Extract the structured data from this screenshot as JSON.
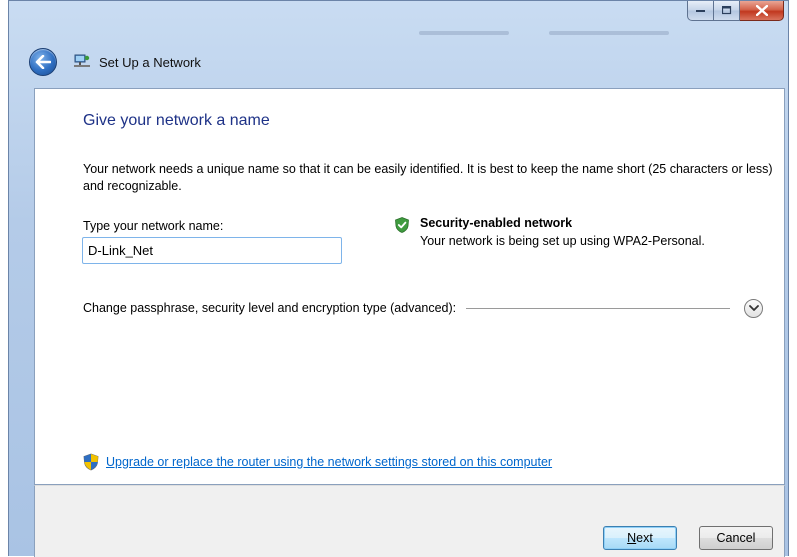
{
  "window": {
    "title": "Set Up a Network",
    "caption_buttons": [
      "minimize",
      "maximize",
      "close"
    ]
  },
  "page": {
    "heading": "Give your network a name",
    "description": "Your network needs a unique name so that it can be easily identified. It is best to keep the name short (25 characters or less) and recognizable.",
    "name_label": "Type your network name:",
    "name_value": "D-Link_Net",
    "security_title": "Security-enabled network",
    "security_subtitle": "Your network is being set up using WPA2-Personal.",
    "advanced_label": "Change passphrase, security level and encryption type (advanced):",
    "upgrade_link": "Upgrade or replace the router using the network settings stored on this computer"
  },
  "footer": {
    "next_mnemonic": "N",
    "next_rest": "ext",
    "cancel_label": "Cancel"
  },
  "icons": {
    "back": "back-arrow-icon",
    "network": "network-icon",
    "security": "shield-check-icon",
    "expand": "chevron-down-icon",
    "uac": "uac-shield-icon"
  },
  "colors": {
    "heading": "#1e3287",
    "link": "#0066cc",
    "close_button": "#c1381f"
  }
}
